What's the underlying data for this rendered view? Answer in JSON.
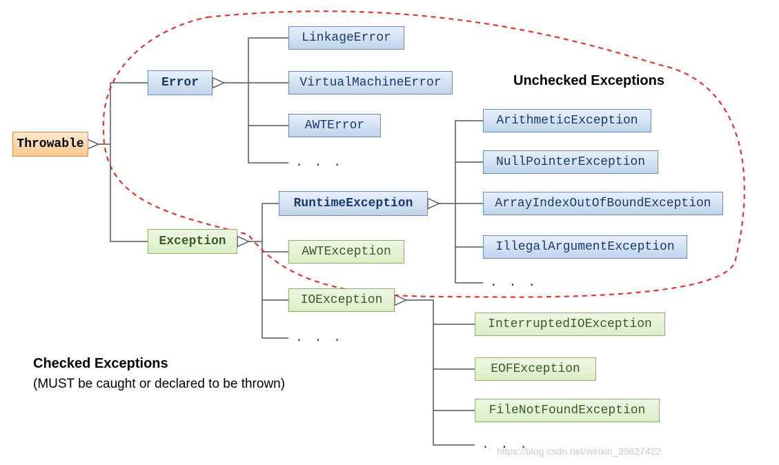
{
  "root": {
    "label": "Throwable"
  },
  "error": {
    "label": "Error",
    "children": [
      "LinkageError",
      "VirtualMachineError",
      "AWTError"
    ],
    "ellipsis": ". . ."
  },
  "exception": {
    "label": "Exception"
  },
  "runtime": {
    "label": "RuntimeException",
    "children": [
      "ArithmeticException",
      "NullPointerException",
      "ArrayIndexOutOfBoundException",
      "IllegalArgumentException"
    ],
    "ellipsis": ". . ."
  },
  "checked_children": {
    "awt": "AWTException",
    "io": "IOException",
    "ellipsis": ". . ."
  },
  "io_children": {
    "items": [
      "InterruptedIOException",
      "EOFException",
      "FileNotFoundException"
    ],
    "ellipsis": ". . ."
  },
  "labels": {
    "unchecked": "Unchecked Exceptions",
    "checked_title": "Checked Exceptions",
    "checked_sub": "(MUST be caught or declared to be thrown)"
  },
  "watermark": "https://blog.csdn.net/weixin_39627422"
}
